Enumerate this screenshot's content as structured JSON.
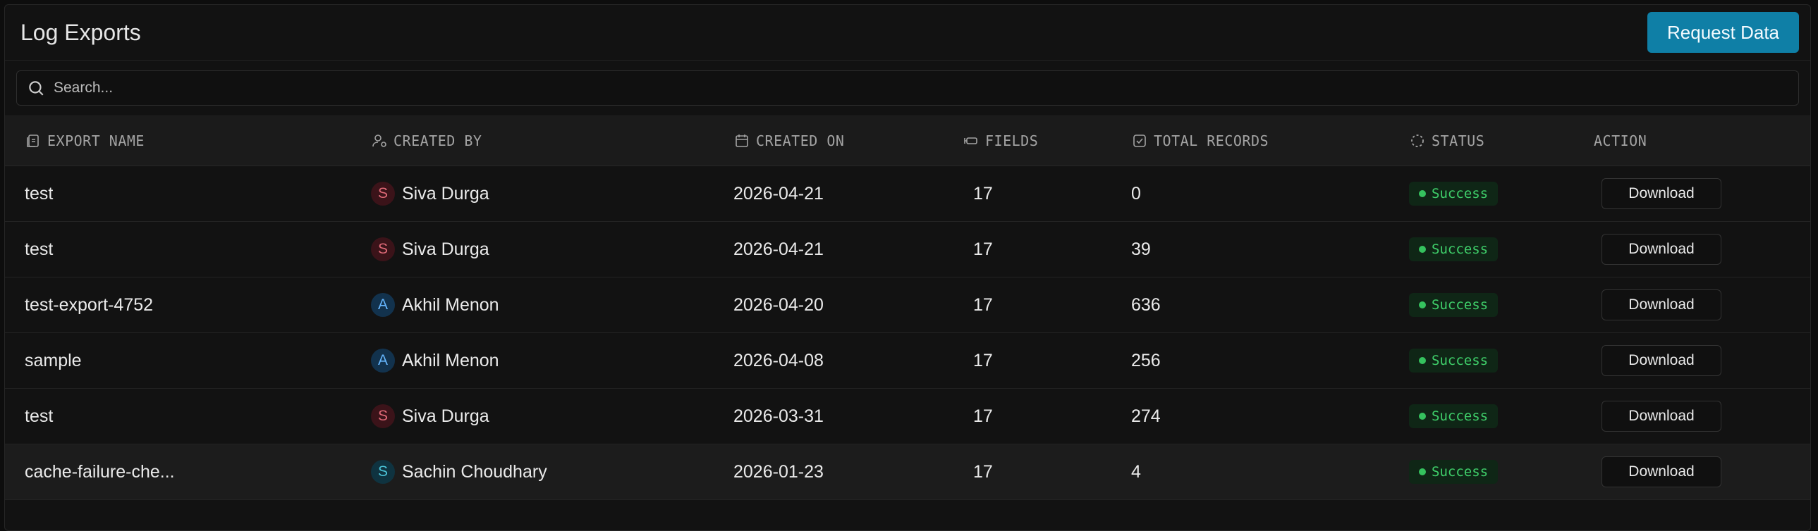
{
  "header": {
    "title": "Log Exports",
    "request_button": "Request Data"
  },
  "search": {
    "placeholder": "Search..."
  },
  "columns": {
    "export_name": "EXPORT NAME",
    "created_by": "CREATED BY",
    "created_on": "CREATED ON",
    "fields": "FIELDS",
    "total_records": "TOTAL RECORDS",
    "status": "STATUS",
    "action": "ACTION"
  },
  "rows": [
    {
      "name": "test",
      "initial": "S",
      "user": "Siva Durga",
      "date": "2026-04-21",
      "fields": "17",
      "records": "0",
      "status": "Success",
      "action": "Download"
    },
    {
      "name": "test",
      "initial": "S",
      "user": "Siva Durga",
      "date": "2026-04-21",
      "fields": "17",
      "records": "39",
      "status": "Success",
      "action": "Download"
    },
    {
      "name": "test-export-4752",
      "initial": "A",
      "user": "Akhil Menon",
      "date": "2026-04-20",
      "fields": "17",
      "records": "636",
      "status": "Success",
      "action": "Download"
    },
    {
      "name": "sample",
      "initial": "A",
      "user": "Akhil Menon",
      "date": "2026-04-08",
      "fields": "17",
      "records": "256",
      "status": "Success",
      "action": "Download"
    },
    {
      "name": "test",
      "initial": "S",
      "user": "Siva Durga",
      "date": "2026-03-31",
      "fields": "17",
      "records": "274",
      "status": "Success",
      "action": "Download"
    },
    {
      "name": "cache-failure-che...",
      "initial": "S",
      "user": "Sachin Choudhary",
      "date": "2026-01-23",
      "fields": "17",
      "records": "4",
      "status": "Success",
      "action": "Download"
    }
  ],
  "colors": {
    "accent": "#0f7fa6",
    "success": "#3fcf6a"
  }
}
